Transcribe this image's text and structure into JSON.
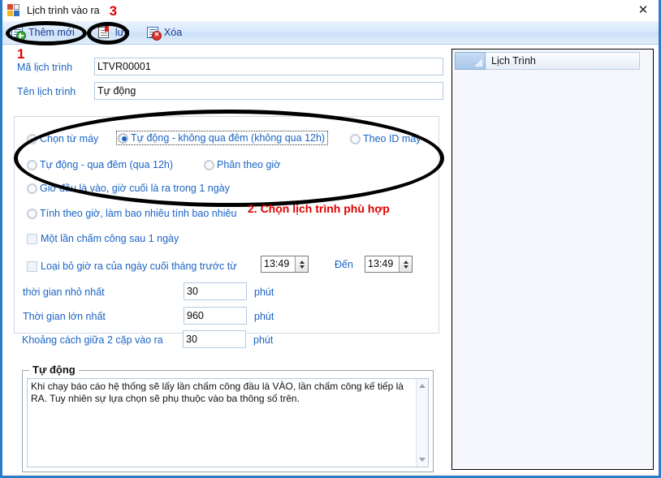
{
  "window": {
    "title": "Lịch trình vào ra",
    "icon": "app-window-icon",
    "close_label": "✕"
  },
  "toolbar": {
    "items": [
      {
        "label": "Thêm mới",
        "icon": "add-new-icon"
      },
      {
        "label": "lưu",
        "icon": "save-icon"
      },
      {
        "label": "Xóa",
        "icon": "delete-icon"
      }
    ]
  },
  "form": {
    "code_label": "Mã lịch trình",
    "code_value": "LTVR00001",
    "name_label": "Tên lịch trình",
    "name_value": "Tự động",
    "radios": [
      {
        "label": "Chọn từ máy",
        "selected": false
      },
      {
        "label": "Tự động - không qua đêm (không qua 12h)",
        "selected": true
      },
      {
        "label": "Theo ID máy",
        "selected": false
      },
      {
        "label": "Tự động - qua đêm (qua 12h)",
        "selected": false
      },
      {
        "label": "Phân theo giờ",
        "selected": false
      },
      {
        "label": "Giờ đầu là vào, giờ cuối là ra trong 1 ngày",
        "selected": false
      },
      {
        "label": "Tính theo giờ, làm bao nhiêu tính bao nhiêu",
        "selected": false
      }
    ],
    "checkboxes": [
      {
        "label": "Một lần chấm công sau 1 ngày",
        "checked": false
      },
      {
        "label": "Loại bỏ giờ ra của ngày cuối tháng trước từ",
        "checked": false
      }
    ],
    "time_from_value": "13:49",
    "time_to_label": "Đến",
    "time_to_value": "13:49",
    "numeric_rows": [
      {
        "label": "thời gian nhỏ nhất",
        "value": "30",
        "unit": "phút"
      },
      {
        "label": "Thời gian lớn nhất",
        "value": "960",
        "unit": "phút"
      },
      {
        "label": "Khoảng cách giữa 2 cặp vào ra",
        "value": "30",
        "unit": "phút"
      }
    ],
    "description_caption": "Tự động",
    "description_text": "Khi chạy báo cáo hệ thống sẽ lấy lần chấm công đầu là VÀO, lần chấm công kế tiếp là RA. Tuy nhiên sự lựa chọn sẽ phụ thuộc vào ba thông số trên."
  },
  "grid": {
    "column_header": "Lịch Trình",
    "rows": []
  },
  "annotations": {
    "step1": "1",
    "step2": "2. Chọn lịch trình phù hợp",
    "step3": "3"
  },
  "colors": {
    "accent_blue": "#1a63c4",
    "annotation_red": "#e00000",
    "window_border": "#2a7cc7",
    "toolbar_top": "#eaf3fd"
  }
}
